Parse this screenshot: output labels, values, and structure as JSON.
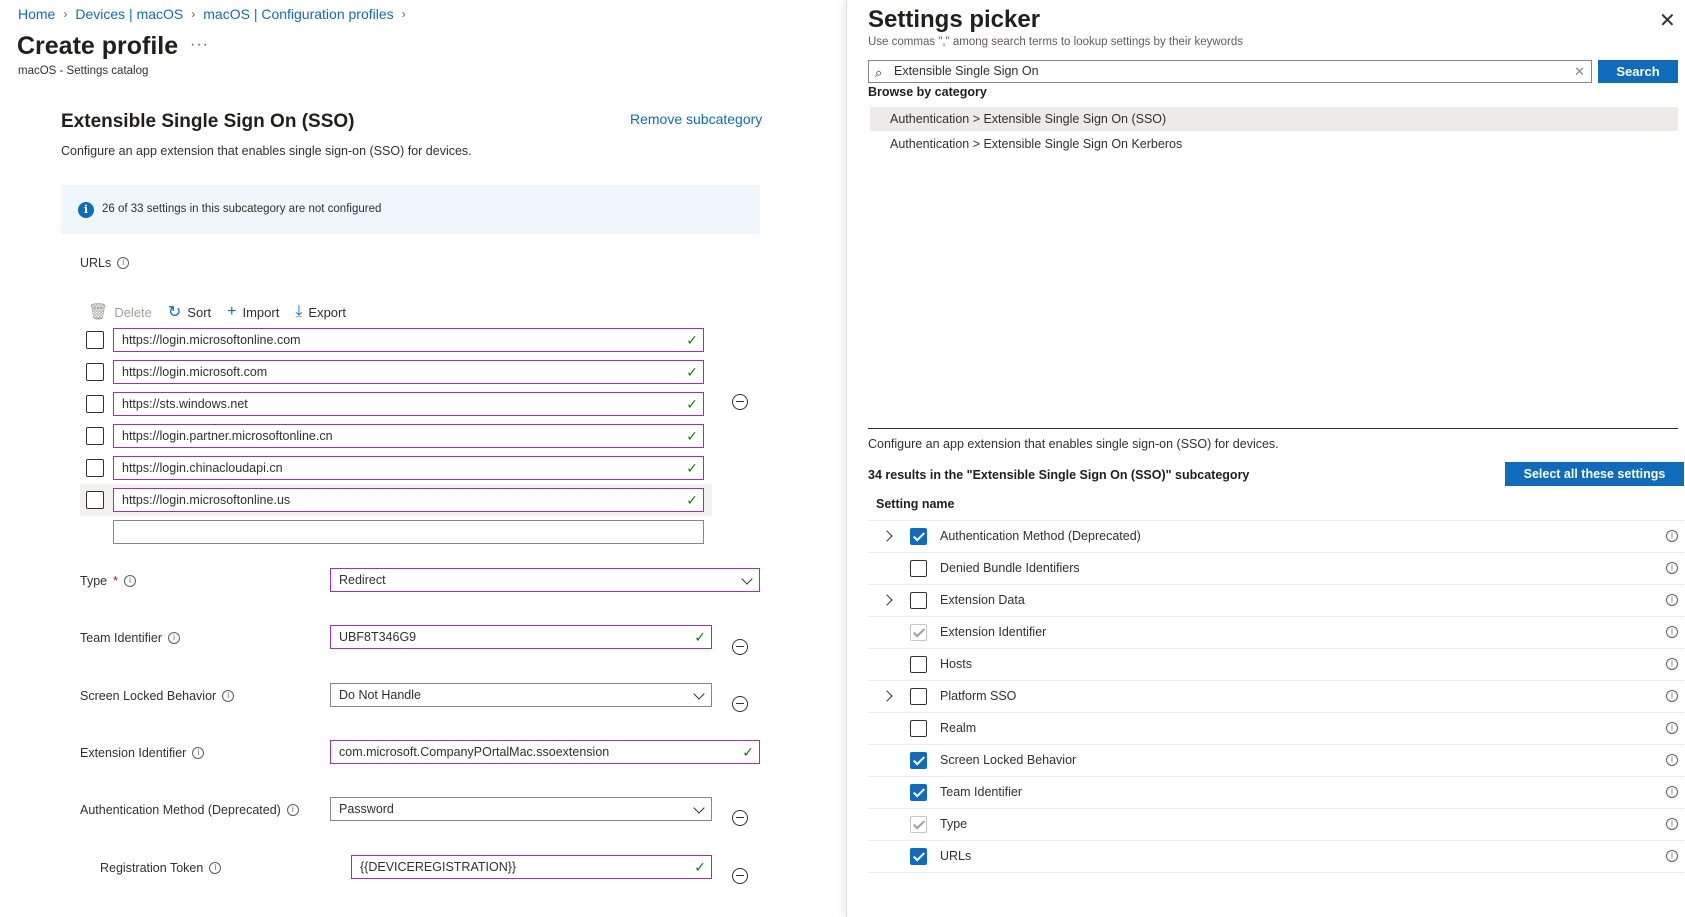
{
  "breadcrumb": [
    "Home",
    "Devices | macOS",
    "macOS | Configuration profiles"
  ],
  "page": {
    "title": "Create profile",
    "more": "···",
    "subtitle": "macOS - Settings catalog"
  },
  "subcategory": {
    "title": "Extensible Single Sign On (SSO)",
    "remove_label": "Remove subcategory",
    "description": "Configure an app extension that enables single sign-on (SSO) for devices.",
    "info_text": "26 of 33 settings in this subcategory are not configured"
  },
  "urls": {
    "label": "URLs",
    "toolbar": {
      "delete": "Delete",
      "sort": "Sort",
      "import": "Import",
      "export": "Export"
    },
    "items": [
      "https://login.microsoftonline.com",
      "https://login.microsoft.com",
      "https://sts.windows.net",
      "https://login.partner.microsoftonline.cn",
      "https://login.chinacloudapi.cn",
      "https://login.microsoftonline.us"
    ],
    "new_item": ""
  },
  "fields": {
    "type": {
      "label": "Type",
      "required": "*",
      "value": "Redirect"
    },
    "team_identifier": {
      "label": "Team Identifier",
      "value": "UBF8T346G9"
    },
    "screen_locked": {
      "label": "Screen Locked Behavior",
      "value": "Do Not Handle"
    },
    "extension_identifier": {
      "label": "Extension Identifier",
      "value": "com.microsoft.CompanyPOrtalMac.ssoextension"
    },
    "auth_method": {
      "label": "Authentication Method (Deprecated)",
      "value": "Password"
    },
    "registration_token": {
      "label": "Registration Token",
      "value": "{{DEVICEREGISTRATION}}"
    }
  },
  "picker": {
    "title": "Settings picker",
    "hint": "Use commas \",\" among search terms to lookup settings by their keywords",
    "search_value": "Extensible Single Sign On",
    "search_button": "Search",
    "browse_title": "Browse by category",
    "categories": [
      "Authentication > Extensible Single Sign On (SSO)",
      "Authentication > Extensible Single Sign On Kerberos"
    ],
    "description": "Configure an app extension that enables single sign-on (SSO) for devices.",
    "results_text": "34 results in the \"Extensible Single Sign On (SSO)\" subcategory",
    "select_all": "Select all these settings",
    "column_header": "Setting name",
    "settings": [
      {
        "name": "Authentication Method (Deprecated)",
        "state": "checked",
        "expandable": true
      },
      {
        "name": "Denied Bundle Identifiers",
        "state": "unchecked",
        "expandable": false
      },
      {
        "name": "Extension Data",
        "state": "unchecked",
        "expandable": true
      },
      {
        "name": "Extension Identifier",
        "state": "disabled-checked",
        "expandable": false
      },
      {
        "name": "Hosts",
        "state": "unchecked",
        "expandable": false
      },
      {
        "name": "Platform SSO",
        "state": "unchecked",
        "expandable": true
      },
      {
        "name": "Realm",
        "state": "unchecked",
        "expandable": false
      },
      {
        "name": "Screen Locked Behavior",
        "state": "checked",
        "expandable": false
      },
      {
        "name": "Team Identifier",
        "state": "checked",
        "expandable": false
      },
      {
        "name": "Type",
        "state": "disabled-checked",
        "expandable": false
      },
      {
        "name": "URLs",
        "state": "checked",
        "expandable": false
      }
    ]
  },
  "colors": {
    "accent": "#0f6cbd",
    "field_border": "#9b30c8",
    "valid": "#107c10",
    "info_bg": "#eff6fc"
  }
}
